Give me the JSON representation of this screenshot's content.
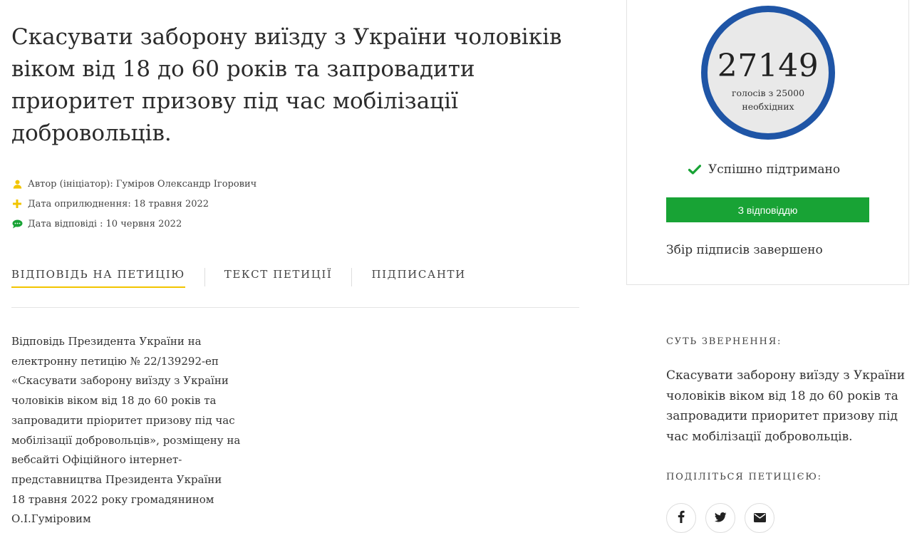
{
  "petition": {
    "title": "Скасувати заборону виїзду з України чоловіків віком від 18 до 60 років та запровадити приоритет призову під час мобілізації добровольців.",
    "meta": {
      "author_label": "Автор (ініціатор):",
      "author_value": "Гуміров Олександр Ігорович",
      "published_label": "Дата оприлюднення:",
      "published_value": "18 травня 2022",
      "answer_date_label": "Дата відповіді :",
      "answer_date_value": "10 червня 2022"
    }
  },
  "tabs": [
    {
      "label": "ВІДПОВІДЬ НА ПЕТИЦІЮ",
      "active": true
    },
    {
      "label": "ТЕКСТ ПЕТИЦІЇ",
      "active": false
    },
    {
      "label": "ПІДПИСАНТИ",
      "active": false
    }
  ],
  "answer_text": "Відповідь Президента України на\nелектронну петицію № 22/139292-еп\n«Скасувати заборону виїзду з України\nчоловіків віком від 18 до 60 років та\nзапровадити пріоритет призову під час\nмобілізації добровольців», розміщену на\nвебсайті Офіційного інтернет-\nпредставництва Президента України\n18 травня 2022 року громадянином\nО.І.Гуміровим",
  "votes": {
    "count": "27149",
    "sub_text": "голосів з 25000 необхідних"
  },
  "status": {
    "text": "Успішно підтримано",
    "button_label": "З відповіддю",
    "collect_text": "Збір підписів завершено"
  },
  "summary": {
    "heading": "СУТЬ ЗВЕРНЕННЯ:",
    "text": "Скасувати заборону виїзду з України чоловіків віком від 18 до 60 років та запровадити приоритет призову під час мобілізації добровольців."
  },
  "share": {
    "heading": "ПОДІЛІТЬСЯ ПЕТИЦІЄЮ:",
    "icons": [
      "facebook-icon",
      "twitter-icon",
      "email-icon"
    ]
  },
  "colors": {
    "accent_blue": "#1f55a6",
    "accent_green": "#18a335",
    "tab_underline": "#f2c500",
    "meta_icon_yellow": "#f2c500",
    "meta_icon_green": "#18a335"
  }
}
